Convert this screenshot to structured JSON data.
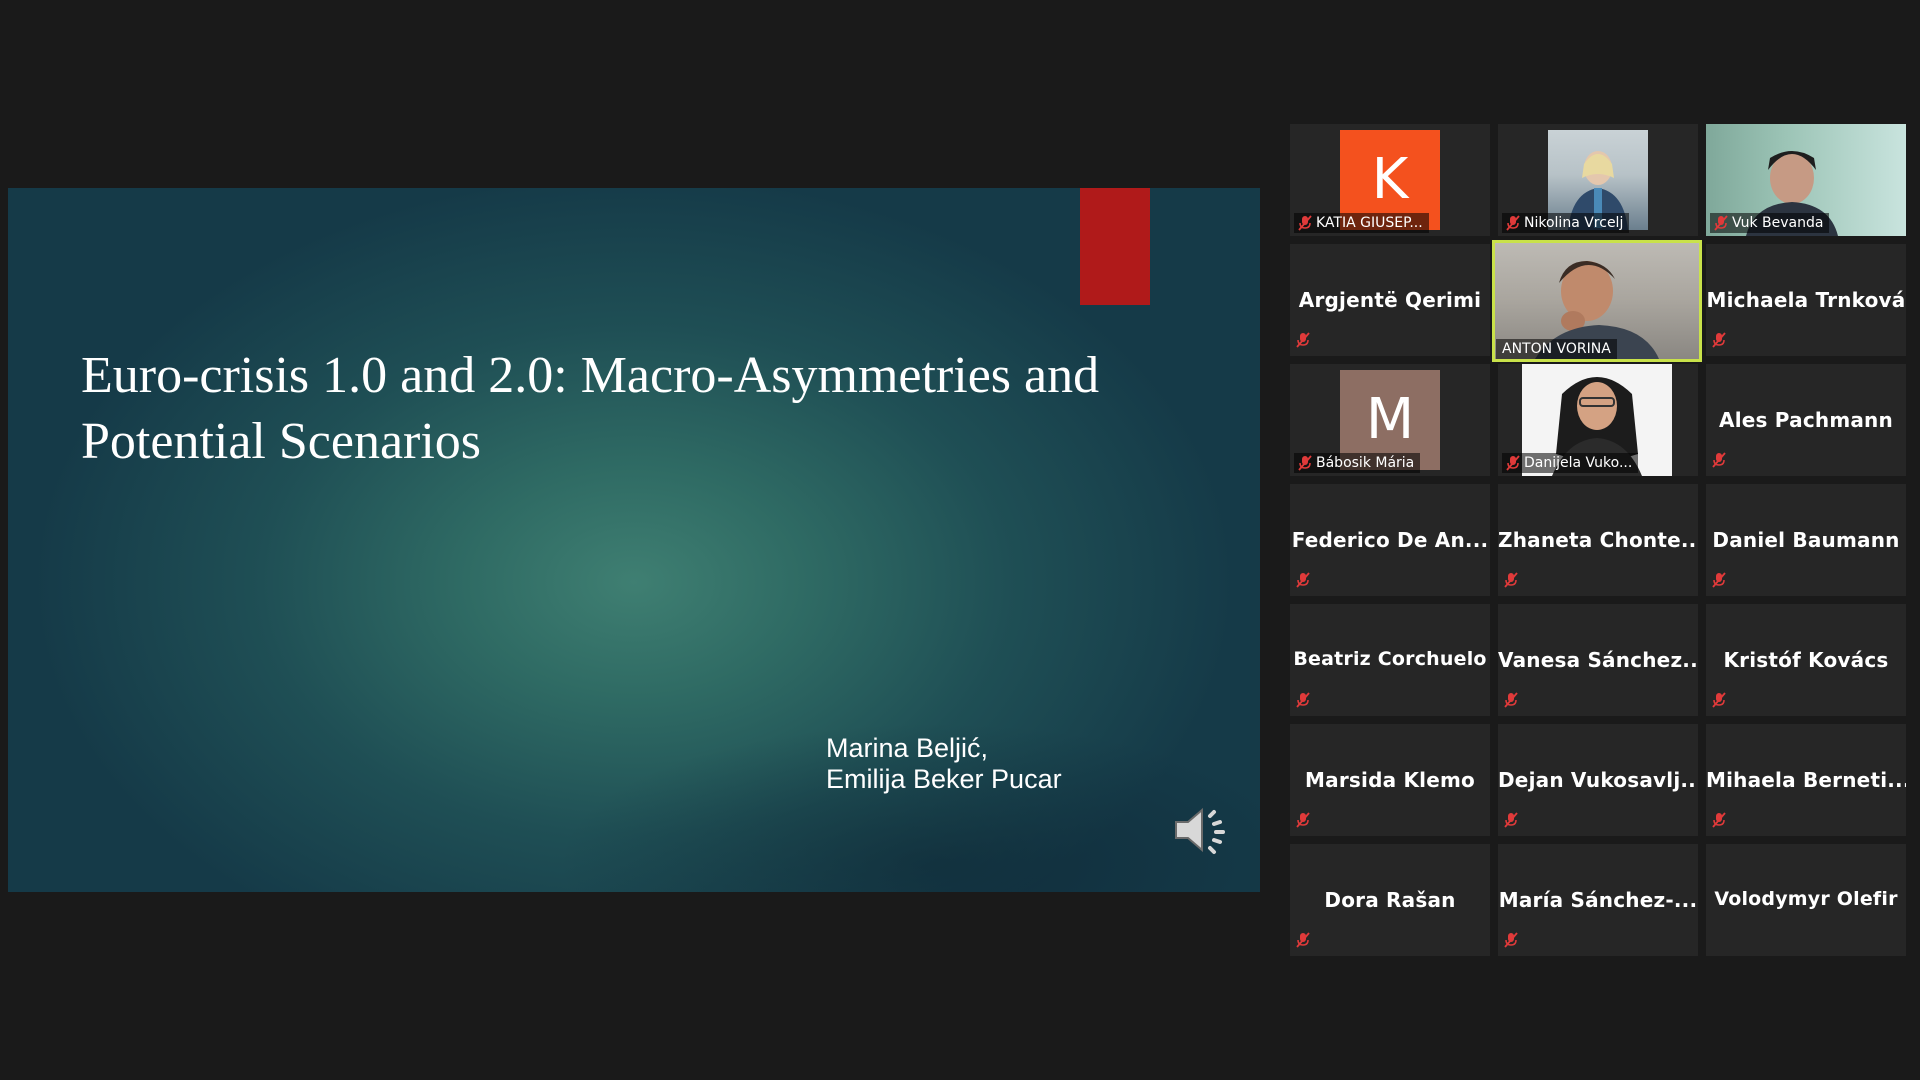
{
  "slide": {
    "title": "Euro-crisis 1.0 and 2.0: Macro-Asymmetries and Potential Scenarios",
    "authors": [
      "Marina Beljić,",
      "Emilija Beker Pucar"
    ],
    "accent_color": "#b01a1a"
  },
  "participants": [
    {
      "name": "KATIA GIUSEP...",
      "type": "avatar",
      "letter": "K",
      "avatar_color": "#f4511e",
      "muted": true
    },
    {
      "name": "Nikolina Vrcelj",
      "type": "video",
      "muted": true
    },
    {
      "name": "Vuk Bevanda",
      "type": "video",
      "muted": true
    },
    {
      "name": "Argjentë Qerimi",
      "type": "name",
      "muted": true
    },
    {
      "name": "ANTON VORINA",
      "type": "video",
      "speaking": true,
      "muted": false
    },
    {
      "name": "Michaela Trnková",
      "type": "name",
      "muted": true
    },
    {
      "name": "Bábosik Mária",
      "type": "avatar",
      "letter": "M",
      "avatar_color": "#8d6e63",
      "muted": true
    },
    {
      "name": "Danijela Vuko...",
      "type": "video",
      "muted": true
    },
    {
      "name": "Ales Pachmann",
      "type": "name",
      "muted": true
    },
    {
      "name": "Federico De An...",
      "type": "name",
      "muted": true
    },
    {
      "name": "Zhaneta Chonte...",
      "type": "name",
      "muted": true
    },
    {
      "name": "Daniel Baumann",
      "type": "name",
      "muted": true
    },
    {
      "name": "Beatriz Corchuelo",
      "type": "name",
      "muted": true
    },
    {
      "name": "Vanesa Sánchez...",
      "type": "name",
      "muted": true
    },
    {
      "name": "Kristóf Kovács",
      "type": "name",
      "muted": true
    },
    {
      "name": "Marsida Klemo",
      "type": "name",
      "muted": true
    },
    {
      "name": "Dejan Vukosavlj...",
      "type": "name",
      "muted": true
    },
    {
      "name": "Mihaela Berneti...",
      "type": "name",
      "muted": true
    },
    {
      "name": "Dora Rašan",
      "type": "name",
      "muted": true
    },
    {
      "name": "María Sánchez-...",
      "type": "name",
      "muted": true
    },
    {
      "name": "Volodymyr Olefir",
      "type": "name",
      "muted": false
    }
  ],
  "icons": {
    "muted": "microphone-muted-icon",
    "audio": "speaker-icon"
  },
  "colors": {
    "speaking_border": "#c9e24a",
    "muted_icon": "#e03a3a",
    "tile_bg": "#262626",
    "app_bg": "#1a1a1a"
  }
}
